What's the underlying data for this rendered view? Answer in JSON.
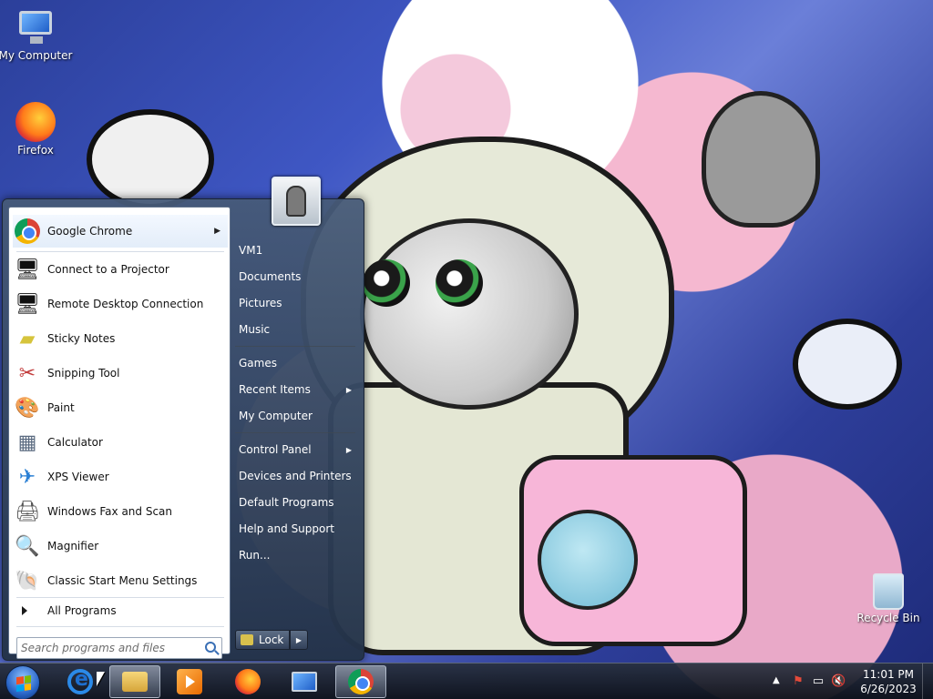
{
  "desktop": {
    "icons": [
      {
        "label": "My Computer",
        "icon": "computer-icon"
      },
      {
        "label": "Firefox",
        "icon": "firefox-icon"
      },
      {
        "label": "Recycle Bin",
        "icon": "recycle-bin-icon"
      }
    ]
  },
  "start_menu": {
    "programs": [
      {
        "label": "Google Chrome",
        "icon": "chrome-icon",
        "has_submenu": true
      },
      {
        "label": "Connect to a Projector",
        "icon": "projector-icon"
      },
      {
        "label": "Remote Desktop Connection",
        "icon": "remote-desktop-icon"
      },
      {
        "label": "Sticky Notes",
        "icon": "sticky-notes-icon"
      },
      {
        "label": "Snipping Tool",
        "icon": "scissors-icon"
      },
      {
        "label": "Paint",
        "icon": "paint-icon"
      },
      {
        "label": "Calculator",
        "icon": "calculator-icon"
      },
      {
        "label": "XPS Viewer",
        "icon": "xps-viewer-icon"
      },
      {
        "label": "Windows Fax and Scan",
        "icon": "fax-icon"
      },
      {
        "label": "Magnifier",
        "icon": "magnifier-icon"
      },
      {
        "label": "Classic Start Menu Settings",
        "icon": "shell-icon"
      }
    ],
    "all_programs": "All Programs",
    "search_placeholder": "Search programs and files",
    "right_items": [
      {
        "label": "VM1"
      },
      {
        "label": "Documents"
      },
      {
        "label": "Pictures"
      },
      {
        "label": "Music"
      },
      {
        "label": "Games"
      },
      {
        "label": "Recent Items",
        "has_submenu": true
      },
      {
        "label": "My Computer"
      },
      {
        "label": "Control Panel",
        "has_submenu": true
      },
      {
        "label": "Devices and Printers"
      },
      {
        "label": "Default Programs"
      },
      {
        "label": "Help and Support"
      },
      {
        "label": "Run..."
      }
    ],
    "lock_label": "Lock"
  },
  "taskbar": {
    "pinned": [
      {
        "name": "Internet Explorer",
        "icon": "ie-icon"
      },
      {
        "name": "Windows Explorer",
        "icon": "folder-icon",
        "active": true
      },
      {
        "name": "Windows Media Player",
        "icon": "media-player-icon"
      },
      {
        "name": "Firefox",
        "icon": "firefox-icon"
      },
      {
        "name": "Network",
        "icon": "network-icon"
      },
      {
        "name": "Google Chrome",
        "icon": "chrome-icon",
        "active": true
      }
    ],
    "clock": {
      "time": "11:01 PM",
      "date": "6/26/2023"
    }
  }
}
